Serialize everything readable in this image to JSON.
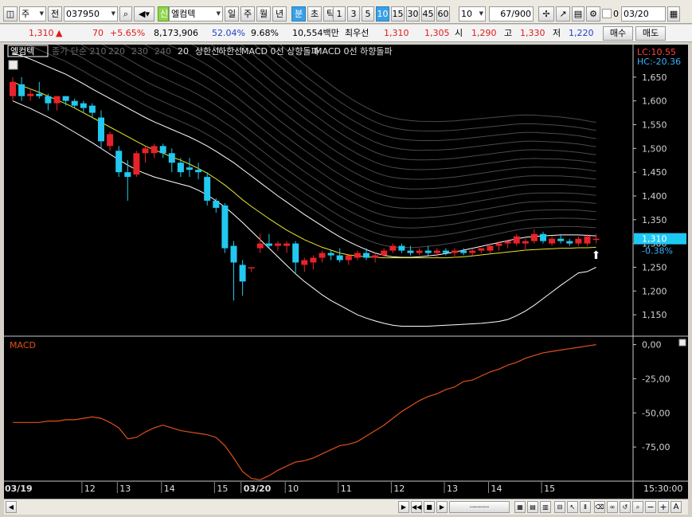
{
  "toolbar": {
    "period_type": "주",
    "prev_label": "전",
    "code": "037950",
    "credit_badge": "신",
    "stock_name": "엘컴텍",
    "tabs": [
      "일",
      "주",
      "월",
      "년",
      "분",
      "초",
      "틱"
    ],
    "active_tab": "분",
    "intervals": [
      "1",
      "3",
      "5",
      "10",
      "15",
      "30",
      "45",
      "60"
    ],
    "active_interval": "10",
    "interval_select": "10",
    "count": "67",
    "count_total": "/900",
    "date_value": "03/20",
    "checkbox_label": "0"
  },
  "infobar": {
    "price": "1,310",
    "change_arrow": "▲",
    "change": "70",
    "change_pct": "+5.65%",
    "volume": "8,173,906",
    "ratio1": "52.04%",
    "ratio2": "9.68%",
    "amount": "10,554백만",
    "best_label": "최우선",
    "best_ask": "1,310",
    "best_bid": "1,305",
    "open_label": "시",
    "open": "1,290",
    "high_label": "고",
    "high": "1,330",
    "low_label": "저",
    "low": "1,220",
    "buy_label": "매수",
    "sell_label": "매도"
  },
  "colors": {
    "up": "#e8222a",
    "down": "#22c8f0",
    "ma20": "#e8e82a",
    "envelope": "#ffffff",
    "macd": "#e0501a",
    "price_tag": "#1ec8f5",
    "grid": "#5a5a5a"
  },
  "icons": [
    "search-icon",
    "speaker-icon",
    "crosshair-icon",
    "line-tool-icon",
    "print-icon",
    "save-icon",
    "gear-icon"
  ],
  "chart_data": [
    {
      "type": "candlestick",
      "title": "엘컴텍",
      "legend": [
        "종가 단순 210",
        "220",
        "230",
        "240",
        "20",
        "상한선",
        "하한선",
        "MACD 0선 상향돌파",
        "MACD 0선 하향돌파"
      ],
      "indicator_top_right": [
        "LC:10.55",
        "HC:-20.36"
      ],
      "current_price_tag": "1,310",
      "current_change_tag": "-0.38%",
      "ylim": [
        1105,
        1705
      ],
      "y_ticks": [
        1650,
        1600,
        1550,
        1500,
        1450,
        1400,
        1350,
        1300,
        1250,
        1200,
        1150
      ],
      "y_tick_labels": [
        "1,650",
        "1,600",
        "1,550",
        "1,500",
        "1,450",
        "1,400",
        "1,350",
        "1,300",
        "1,250",
        "1,200",
        "1,150"
      ],
      "x_labels": [
        {
          "index": 0,
          "label": "03/19",
          "bold": true
        },
        {
          "index": 9,
          "label": "12"
        },
        {
          "index": 13,
          "label": "13"
        },
        {
          "index": 18,
          "label": "14"
        },
        {
          "index": 24,
          "label": "15"
        },
        {
          "index": 27,
          "label": "03/20",
          "bold": true
        },
        {
          "index": 32,
          "label": "10"
        },
        {
          "index": 38,
          "label": "11"
        },
        {
          "index": 44,
          "label": "12"
        },
        {
          "index": 50,
          "label": "13"
        },
        {
          "index": 55,
          "label": "14"
        },
        {
          "index": 61,
          "label": "15"
        }
      ],
      "time_label": "15:30:00",
      "candles": [
        {
          "o": 1610,
          "h": 1650,
          "l": 1600,
          "c": 1640
        },
        {
          "o": 1635,
          "h": 1650,
          "l": 1600,
          "c": 1610
        },
        {
          "o": 1610,
          "h": 1625,
          "l": 1600,
          "c": 1615
        },
        {
          "o": 1615,
          "h": 1640,
          "l": 1605,
          "c": 1610
        },
        {
          "o": 1610,
          "h": 1615,
          "l": 1580,
          "c": 1595
        },
        {
          "o": 1595,
          "h": 1610,
          "l": 1580,
          "c": 1610
        },
        {
          "o": 1610,
          "h": 1610,
          "l": 1590,
          "c": 1600
        },
        {
          "o": 1600,
          "h": 1605,
          "l": 1585,
          "c": 1590
        },
        {
          "o": 1595,
          "h": 1600,
          "l": 1575,
          "c": 1585
        },
        {
          "o": 1590,
          "h": 1595,
          "l": 1565,
          "c": 1575
        },
        {
          "o": 1565,
          "h": 1580,
          "l": 1500,
          "c": 1515
        },
        {
          "o": 1505,
          "h": 1535,
          "l": 1495,
          "c": 1530
        },
        {
          "o": 1495,
          "h": 1505,
          "l": 1440,
          "c": 1450
        },
        {
          "o": 1450,
          "h": 1475,
          "l": 1390,
          "c": 1440
        },
        {
          "o": 1445,
          "h": 1495,
          "l": 1440,
          "c": 1490
        },
        {
          "o": 1490,
          "h": 1505,
          "l": 1470,
          "c": 1500
        },
        {
          "o": 1490,
          "h": 1510,
          "l": 1480,
          "c": 1505
        },
        {
          "o": 1505,
          "h": 1510,
          "l": 1480,
          "c": 1490
        },
        {
          "o": 1490,
          "h": 1500,
          "l": 1450,
          "c": 1470
        },
        {
          "o": 1470,
          "h": 1480,
          "l": 1440,
          "c": 1450
        },
        {
          "o": 1460,
          "h": 1480,
          "l": 1440,
          "c": 1455
        },
        {
          "o": 1455,
          "h": 1470,
          "l": 1435,
          "c": 1450
        },
        {
          "o": 1440,
          "h": 1450,
          "l": 1380,
          "c": 1390
        },
        {
          "o": 1390,
          "h": 1395,
          "l": 1365,
          "c": 1375
        },
        {
          "o": 1380,
          "h": 1385,
          "l": 1280,
          "c": 1290
        },
        {
          "o": 1295,
          "h": 1305,
          "l": 1180,
          "c": 1260
        },
        {
          "o": 1255,
          "h": 1265,
          "l": 1190,
          "c": 1220
        },
        {
          "o": 1250,
          "h": 1250,
          "l": 1240,
          "c": 1250
        },
        {
          "o": 1290,
          "h": 1320,
          "l": 1280,
          "c": 1300
        },
        {
          "o": 1300,
          "h": 1320,
          "l": 1290,
          "c": 1295
        },
        {
          "o": 1295,
          "h": 1305,
          "l": 1285,
          "c": 1300
        },
        {
          "o": 1295,
          "h": 1305,
          "l": 1280,
          "c": 1300
        },
        {
          "o": 1300,
          "h": 1305,
          "l": 1235,
          "c": 1260
        },
        {
          "o": 1255,
          "h": 1270,
          "l": 1240,
          "c": 1265
        },
        {
          "o": 1260,
          "h": 1275,
          "l": 1245,
          "c": 1270
        },
        {
          "o": 1270,
          "h": 1285,
          "l": 1260,
          "c": 1280
        },
        {
          "o": 1280,
          "h": 1285,
          "l": 1265,
          "c": 1275
        },
        {
          "o": 1275,
          "h": 1290,
          "l": 1260,
          "c": 1265
        },
        {
          "o": 1265,
          "h": 1275,
          "l": 1255,
          "c": 1275
        },
        {
          "o": 1270,
          "h": 1285,
          "l": 1265,
          "c": 1280
        },
        {
          "o": 1280,
          "h": 1290,
          "l": 1265,
          "c": 1270
        },
        {
          "o": 1270,
          "h": 1280,
          "l": 1260,
          "c": 1275
        },
        {
          "o": 1275,
          "h": 1290,
          "l": 1270,
          "c": 1285
        },
        {
          "o": 1285,
          "h": 1300,
          "l": 1280,
          "c": 1295
        },
        {
          "o": 1295,
          "h": 1300,
          "l": 1280,
          "c": 1285
        },
        {
          "o": 1285,
          "h": 1295,
          "l": 1275,
          "c": 1280
        },
        {
          "o": 1280,
          "h": 1290,
          "l": 1275,
          "c": 1285
        },
        {
          "o": 1285,
          "h": 1295,
          "l": 1275,
          "c": 1280
        },
        {
          "o": 1280,
          "h": 1290,
          "l": 1270,
          "c": 1285
        },
        {
          "o": 1285,
          "h": 1290,
          "l": 1275,
          "c": 1280
        },
        {
          "o": 1280,
          "h": 1290,
          "l": 1270,
          "c": 1285
        },
        {
          "o": 1285,
          "h": 1290,
          "l": 1275,
          "c": 1280
        },
        {
          "o": 1280,
          "h": 1290,
          "l": 1275,
          "c": 1285
        },
        {
          "o": 1285,
          "h": 1290,
          "l": 1280,
          "c": 1290
        },
        {
          "o": 1285,
          "h": 1300,
          "l": 1280,
          "c": 1295
        },
        {
          "o": 1295,
          "h": 1305,
          "l": 1285,
          "c": 1300
        },
        {
          "o": 1300,
          "h": 1305,
          "l": 1290,
          "c": 1305
        },
        {
          "o": 1300,
          "h": 1320,
          "l": 1295,
          "c": 1315
        },
        {
          "o": 1300,
          "h": 1310,
          "l": 1285,
          "c": 1305
        },
        {
          "o": 1305,
          "h": 1330,
          "l": 1300,
          "c": 1320
        },
        {
          "o": 1320,
          "h": 1325,
          "l": 1300,
          "c": 1305
        },
        {
          "o": 1300,
          "h": 1315,
          "l": 1295,
          "c": 1310
        },
        {
          "o": 1310,
          "h": 1320,
          "l": 1300,
          "c": 1305
        },
        {
          "o": 1305,
          "h": 1310,
          "l": 1295,
          "c": 1300
        },
        {
          "o": 1300,
          "h": 1315,
          "l": 1295,
          "c": 1310
        },
        {
          "o": 1300,
          "h": 1320,
          "l": 1295,
          "c": 1315
        },
        {
          "o": 1310,
          "h": 1320,
          "l": 1300,
          "c": 1310
        }
      ],
      "ma20": [
        1640,
        1632,
        1625,
        1618,
        1610,
        1602,
        1594,
        1585,
        1575,
        1565,
        1555,
        1545,
        1535,
        1525,
        1515,
        1505,
        1497,
        1490,
        1482,
        1475,
        1467,
        1458,
        1448,
        1436,
        1423,
        1408,
        1392,
        1378,
        1365,
        1352,
        1340,
        1328,
        1318,
        1308,
        1300,
        1292,
        1286,
        1280,
        1276,
        1274,
        1272,
        1271,
        1270,
        1270,
        1270,
        1270,
        1270,
        1270,
        1270,
        1270,
        1271,
        1272,
        1274,
        1276,
        1278,
        1280,
        1282,
        1284,
        1286,
        1287,
        1288,
        1289,
        1290,
        1290,
        1291,
        1291,
        1292
      ],
      "upper_band": [
        1700,
        1695,
        1688,
        1680,
        1672,
        1664,
        1656,
        1646,
        1636,
        1625,
        1615,
        1605,
        1595,
        1585,
        1575,
        1565,
        1556,
        1548,
        1540,
        1532,
        1524,
        1515,
        1505,
        1494,
        1482,
        1470,
        1456,
        1442,
        1428,
        1414,
        1400,
        1387,
        1374,
        1361,
        1349,
        1337,
        1325,
        1314,
        1304,
        1295,
        1287,
        1280,
        1275,
        1272,
        1271,
        1271,
        1272,
        1274,
        1276,
        1279,
        1282,
        1286,
        1290,
        1294,
        1298,
        1302,
        1306,
        1310,
        1313,
        1315,
        1316,
        1317,
        1318,
        1318,
        1318,
        1317,
        1316
      ],
      "lower_band": [
        1600,
        1592,
        1584,
        1575,
        1566,
        1556,
        1545,
        1534,
        1523,
        1512,
        1500,
        1488,
        1476,
        1465,
        1455,
        1447,
        1440,
        1435,
        1430,
        1425,
        1420,
        1412,
        1402,
        1390,
        1377,
        1361,
        1344,
        1326,
        1308,
        1290,
        1272,
        1254,
        1236,
        1220,
        1206,
        1192,
        1180,
        1170,
        1160,
        1150,
        1143,
        1137,
        1132,
        1128,
        1126,
        1126,
        1126,
        1126,
        1127,
        1128,
        1129,
        1130,
        1131,
        1132,
        1134,
        1136,
        1140,
        1148,
        1158,
        1170,
        1184,
        1198,
        1212,
        1225,
        1238,
        1241,
        1250
      ],
      "ma_fan_offsets": [
        20,
        40,
        60,
        80,
        100,
        120,
        140,
        160,
        180,
        200,
        220,
        240,
        260,
        280
      ]
    },
    {
      "type": "line",
      "title": "MACD",
      "ylim": [
        -100,
        5
      ],
      "y_ticks": [
        0,
        -25,
        -50,
        -75
      ],
      "y_tick_labels": [
        "0,00",
        "-25,00",
        "-50,00",
        "-75,00"
      ],
      "series": [
        {
          "name": "MACD",
          "values": [
            -57,
            -57,
            -57,
            -57,
            -56,
            -56,
            -55,
            -55,
            -54,
            -53,
            -54,
            -57,
            -61,
            -69,
            -68,
            -64,
            -61,
            -59,
            -61,
            -63,
            -64,
            -65,
            -66,
            -68,
            -74,
            -83,
            -93,
            -98,
            -99,
            -96,
            -92,
            -89,
            -86,
            -85,
            -83,
            -80,
            -77,
            -74,
            -73,
            -71,
            -67,
            -63,
            -59,
            -54,
            -49,
            -45,
            -41,
            -38,
            -36,
            -33,
            -31,
            -27,
            -26,
            -23,
            -20,
            -18,
            -15,
            -13,
            -10,
            -8,
            -6,
            -5,
            -4,
            -3,
            -2,
            -1,
            0
          ]
        }
      ]
    }
  ]
}
